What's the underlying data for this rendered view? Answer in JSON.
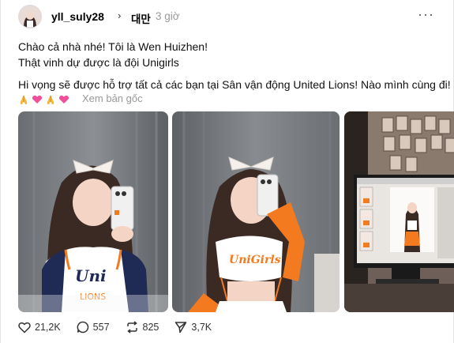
{
  "post": {
    "username": "yll_suly28",
    "separator": "›",
    "location": "대만",
    "time": "3 giờ",
    "more_label": "···",
    "lines": [
      "Chào cả nhà nhé! Tôi là Wen Huizhen!",
      "Thật vinh dự được là đội Unigirls",
      "Hi vọng sẽ được hỗ trợ tất cả các bạn tại Sân vận động United Lions! Nào mình cùng đi!"
    ],
    "emojis": [
      "folded-hands-icon",
      "pink-heart-icon",
      "folded-hands-icon",
      "pink-heart-icon"
    ],
    "translate_label": "Xem bản gốc",
    "photos": [
      "photo-1",
      "photo-2",
      "photo-3"
    ]
  },
  "actions": {
    "likes": "21,2K",
    "replies": "557",
    "reposts": "825",
    "shares": "3,7K"
  },
  "colors": {
    "text": "#111111",
    "muted": "#999999",
    "orange": "#f47a20",
    "navy": "#1f2a55"
  }
}
